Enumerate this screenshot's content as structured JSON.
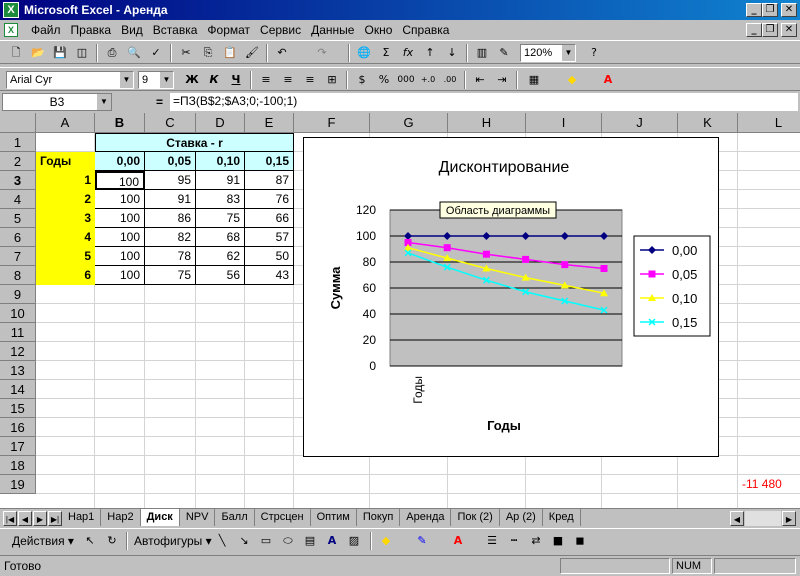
{
  "window": {
    "title": "Microsoft Excel - Аренда",
    "minimize": "_",
    "restore": "❐",
    "close": "✕"
  },
  "menu": [
    "Файл",
    "Правка",
    "Вид",
    "Вставка",
    "Формат",
    "Сервис",
    "Данные",
    "Окно",
    "Справка"
  ],
  "toolbar": {
    "zoom": "120%",
    "font_name": "Arial Cyr",
    "font_size": "9",
    "bold": "Ж",
    "italic": "К",
    "underline": "Ч",
    "percent": "%",
    "thousands": "000",
    "sigma": "Σ",
    "fx": "fx"
  },
  "formula_bar": {
    "name_box": "B3",
    "equals": "=",
    "formula": "=ПЗ(B$2;$A3;0;-100;1)"
  },
  "columns": [
    "A",
    "B",
    "C",
    "D",
    "E",
    "F",
    "G",
    "H",
    "I",
    "J",
    "K",
    "L"
  ],
  "rows": [
    "1",
    "2",
    "3",
    "4",
    "5",
    "6",
    "7",
    "8",
    "9",
    "10",
    "11",
    "12",
    "13",
    "14",
    "15",
    "16",
    "17",
    "18",
    "19"
  ],
  "sheet": {
    "header_rate": "Ставка - r",
    "header_years": "Годы",
    "rates": [
      "0,00",
      "0,05",
      "0,10",
      "0,15"
    ],
    "years": [
      "1",
      "2",
      "3",
      "4",
      "5",
      "6"
    ],
    "table": [
      [
        "100",
        "95",
        "91",
        "87"
      ],
      [
        "100",
        "91",
        "83",
        "76"
      ],
      [
        "100",
        "86",
        "75",
        "66"
      ],
      [
        "100",
        "82",
        "68",
        "57"
      ],
      [
        "100",
        "78",
        "62",
        "50"
      ],
      [
        "100",
        "75",
        "56",
        "43"
      ]
    ],
    "l19_value": "-11 480"
  },
  "chart_data": {
    "type": "line",
    "title": "Дисконтирование",
    "xlabel": "Годы",
    "ylabel": "Сумма",
    "x_tick_label": "Годы",
    "ylim": [
      0,
      120
    ],
    "yticks": [
      "0",
      "20",
      "40",
      "60",
      "80",
      "100",
      "120"
    ],
    "tooltip": "Область диаграммы",
    "series": [
      {
        "name": "0,00",
        "values": [
          100,
          100,
          100,
          100,
          100,
          100
        ],
        "color": "#000080",
        "marker": "diamond"
      },
      {
        "name": "0,05",
        "values": [
          95,
          91,
          86,
          82,
          78,
          75
        ],
        "color": "#ff00ff",
        "marker": "square"
      },
      {
        "name": "0,10",
        "values": [
          91,
          83,
          75,
          68,
          62,
          56
        ],
        "color": "#ffff00",
        "marker": "triangle"
      },
      {
        "name": "0,15",
        "values": [
          87,
          76,
          66,
          57,
          50,
          43
        ],
        "color": "#00ffff",
        "marker": "x"
      }
    ],
    "plot_bg": "#c0c0c0",
    "legend_position": "right"
  },
  "sheet_tabs": [
    "Нар1",
    "Нар2",
    "Диск",
    "NPV",
    "Балл",
    "Стрсцен",
    "Оптим",
    "Покуп",
    "Аренда",
    "Пок (2)",
    "Ар (2)",
    "Кред"
  ],
  "active_tab": "Диск",
  "drawing_toolbar": {
    "actions": "Действия",
    "autoshapes": "Автофигуры"
  },
  "status": {
    "text": "Готово",
    "num": "NUM"
  },
  "colors": {
    "yellow_fill": "#ffff00",
    "cyan_fill": "#ccffff",
    "title_blue": "#000080",
    "negative_red": "#ff0000"
  }
}
